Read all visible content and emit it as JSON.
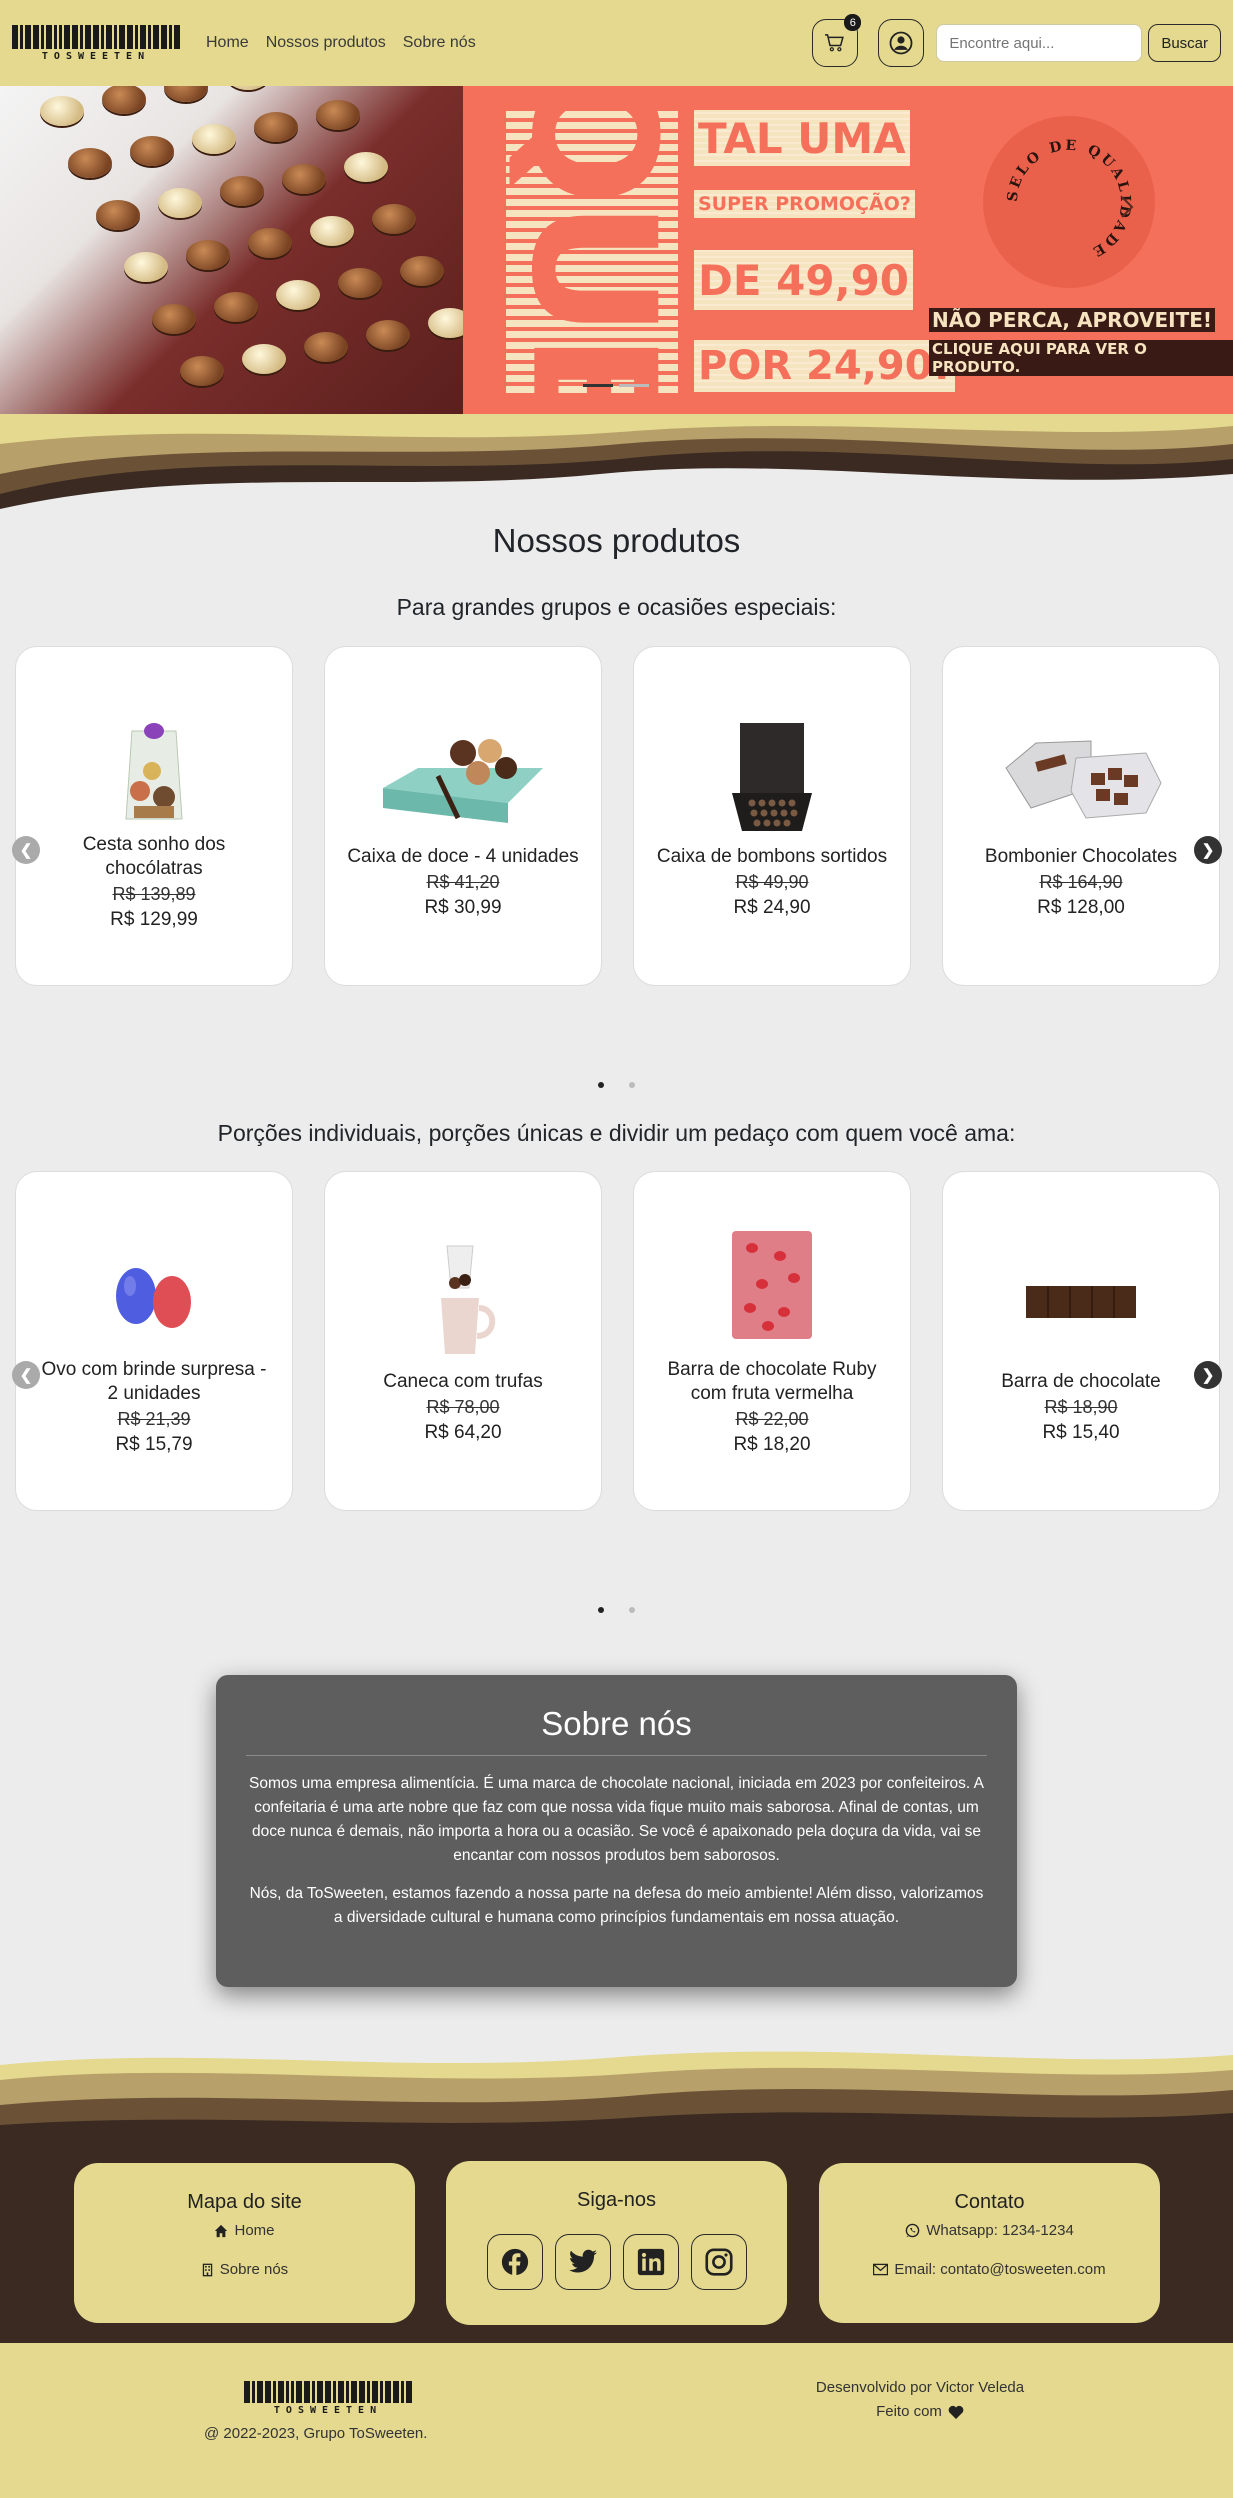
{
  "navbar": {
    "brand": "TOSWEETEN",
    "links": [
      "Home",
      "Nossos produtos",
      "Sobre nós"
    ],
    "cart_count": "6",
    "search_placeholder": "Encontre aqui...",
    "search_button": "Buscar"
  },
  "banner": {
    "que": "QUE",
    "line1": "TAL UMA",
    "line2": "SUPER PROMOÇÃO?",
    "line3": "DE 49,90",
    "line4": "POR 24,90!",
    "cta1": "NÃO PERCA, APROVEITE!",
    "cta2": "CLIQUE AQUI PARA VER O PRODUTO.",
    "seal": "SELO DE QUALIDADE",
    "next_icon": "chevron-right-icon"
  },
  "products": {
    "title": "Nossos produtos",
    "group_subtitle": "Para grandes grupos e ocasiões especiais:",
    "group_items": [
      {
        "name": "Cesta sonho dos chocólatras",
        "old": "R$ 139,89",
        "new": "R$ 129,99"
      },
      {
        "name": "Caixa de doce - 4 unidades",
        "old": "R$ 41,20",
        "new": "R$ 30,99"
      },
      {
        "name": "Caixa de bombons sortidos",
        "old": "R$ 49,90",
        "new": "R$ 24,90"
      },
      {
        "name": "Bombonier Chocolates",
        "old": "R$ 164,90",
        "new": "R$ 128,00"
      }
    ],
    "single_subtitle": "Porções individuais, porções únicas e dividir um pedaço com quem você ama:",
    "single_items": [
      {
        "name": "Ovo com brinde surpresa - 2 unidades",
        "old": "R$ 21,39",
        "new": "R$ 15,79"
      },
      {
        "name": "Caneca com trufas",
        "old": "R$ 78,00",
        "new": "R$ 64,20"
      },
      {
        "name": "Barra de chocolate Ruby com fruta vermelha",
        "old": "R$ 22,00",
        "new": "R$ 18,20"
      },
      {
        "name": "Barra de chocolate",
        "old": "R$ 18,90",
        "new": "R$ 15,40"
      }
    ]
  },
  "about": {
    "title": "Sobre nós",
    "p1": "Somos uma empresa alimentícia. É uma marca de chocolate nacional, iniciada em 2023 por confeiteiros. A confeitaria é uma arte nobre que faz com que nossa vida fique muito mais saborosa. Afinal de contas, um doce nunca é demais, não importa a hora ou a ocasião. Se você é apaixonado pela doçura da vida, vai se encantar com nossos produtos bem saborosos.",
    "p2": "Nós, da ToSweeten, estamos fazendo a nossa parte na defesa do meio ambiente! Além disso, valorizamos a diversidade cultural e humana como princípios fundamentais em nossa atuação."
  },
  "footer": {
    "sitemap_title": "Mapa do site",
    "sitemap_home": "Home",
    "sitemap_about": "Sobre nós",
    "follow_title": "Siga-nos",
    "contact_title": "Contato",
    "whatsapp": "Whatsapp: 1234-1234",
    "email": "Email: contato@tosweeten.com",
    "copyright": "@ 2022-2023, Grupo ToSweeten.",
    "developer": "Desenvolvido por Victor Veleda",
    "made_with": "Feito com"
  },
  "colors": {
    "brand_yellow": "#e4d98e",
    "promo_coral": "#f4705a",
    "dark_brown": "#3a2a22",
    "about_gray": "#5e5e5e"
  }
}
